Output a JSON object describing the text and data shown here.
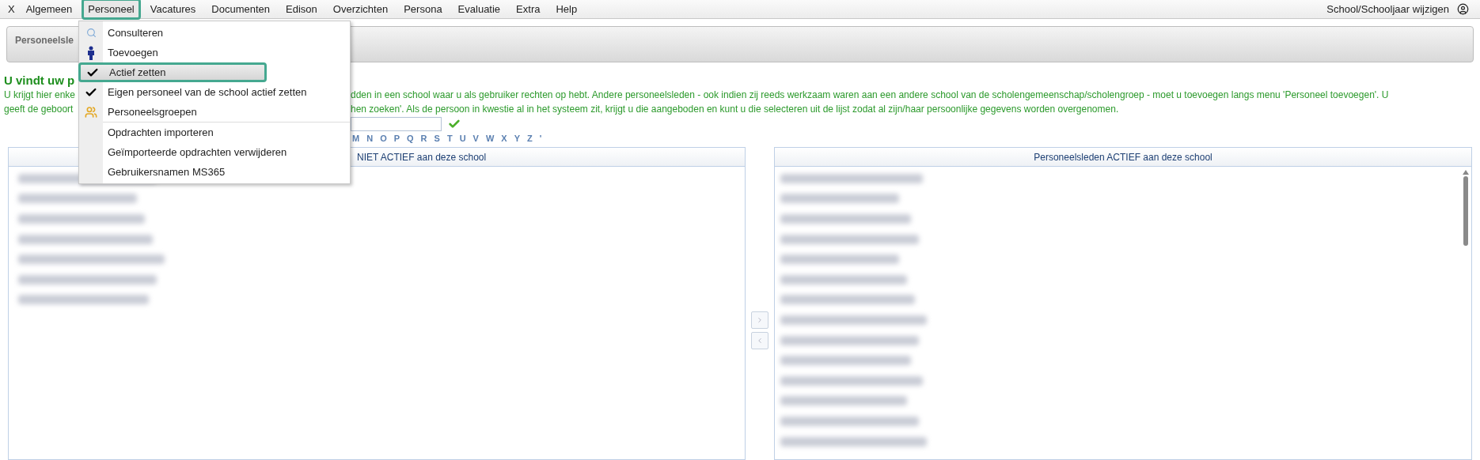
{
  "menu_bar": {
    "close": "X",
    "items": [
      {
        "label": "Algemeen",
        "selected": false
      },
      {
        "label": "Personeel",
        "selected": true
      },
      {
        "label": "Vacatures",
        "selected": false
      },
      {
        "label": "Documenten",
        "selected": false
      },
      {
        "label": "Edison",
        "selected": false
      },
      {
        "label": "Overzichten",
        "selected": false
      },
      {
        "label": "Persona",
        "selected": false
      },
      {
        "label": "Evaluatie",
        "selected": false
      },
      {
        "label": "Extra",
        "selected": false
      },
      {
        "label": "Help",
        "selected": false
      }
    ],
    "school_link": "School/Schooljaar wijzigen"
  },
  "dropdown": {
    "groups": [
      {
        "items": [
          {
            "label": "Consulteren",
            "kind": "magnifier",
            "selected": false
          },
          {
            "label": "Toevoegen",
            "kind": "person",
            "selected": false
          },
          {
            "label": "Actief zetten",
            "kind": "check",
            "selected": true
          },
          {
            "label": "Eigen personeel van de school actief zetten",
            "kind": "check",
            "selected": false
          },
          {
            "label": "Personeelsgroepen",
            "kind": "group",
            "selected": false
          }
        ]
      },
      {
        "items": [
          {
            "label": "Opdrachten importeren",
            "kind": "plain",
            "selected": false
          },
          {
            "label": "Geïmporteerde opdrachten verwijderen",
            "kind": "plain",
            "selected": false
          },
          {
            "label": "Gebruikersnamen MS365",
            "kind": "plain",
            "selected": false
          }
        ]
      }
    ]
  },
  "tab": {
    "title": "Personeelsle"
  },
  "intro": {
    "heading": "U vindt uw p",
    "line_1_left": "U krijgt hier enke",
    "line_1_right": "dden in een school waar u als gebruiker rechten op hebt. Andere personeelsleden - ook indien zij reeds werkzaam waren aan een andere school van de scholengemeenschap/scholengroep - moet u toevoegen langs menu 'Personeel toevoegen'. U",
    "line_2_left": "geeft de geboort",
    "line_2_right": "hen zoeken'. Als de persoon in kwestie al in het systeem zit, krijgt u die aangeboden en kunt u die selecteren uit de lijst zodat al zijn/haar persoonlijke gegevens worden overgenomen."
  },
  "alphabet": [
    "M",
    "N",
    "O",
    "P",
    "Q",
    "R",
    "S",
    "T",
    "U",
    "V",
    "W",
    "X",
    "Y",
    "Z",
    "'"
  ],
  "lists": [
    {
      "header": "NIET ACTIEF aan deze school",
      "rows": [
        {
          "kind": "blurred"
        },
        {
          "kind": "blurred"
        },
        {
          "kind": "blurred"
        },
        {
          "kind": "blurred"
        },
        {
          "kind": "blurred"
        },
        {
          "kind": "blurred"
        },
        {
          "kind": "blurred"
        }
      ]
    },
    {
      "header": "Personeelsleden ACTIEF aan deze school",
      "rows": [
        {
          "kind": "blurred"
        },
        {
          "kind": "blurred"
        },
        {
          "kind": "blurred"
        },
        {
          "kind": "blurred"
        },
        {
          "kind": "blurred"
        },
        {
          "kind": "blurred"
        },
        {
          "kind": "blurred"
        },
        {
          "kind": "blurred"
        },
        {
          "kind": "blurred"
        },
        {
          "kind": "blurred"
        },
        {
          "kind": "blurred"
        },
        {
          "kind": "blurred"
        },
        {
          "kind": "blurred"
        },
        {
          "kind": "blurred"
        }
      ]
    }
  ]
}
